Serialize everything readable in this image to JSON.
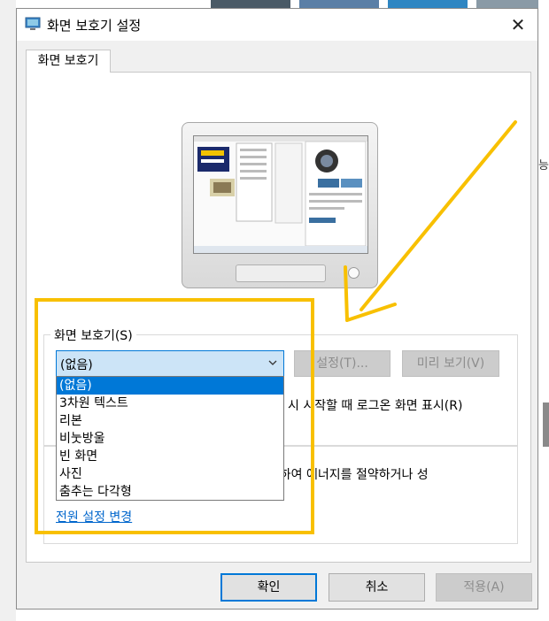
{
  "window": {
    "title": "화면 보호기 설정",
    "close_glyph": "✕",
    "icon": "monitor-icon"
  },
  "tab": {
    "label": "화면 보호기"
  },
  "screensaver": {
    "group_label": "화면 보호기(S)",
    "selected": "(없음)",
    "settings_button": "설정(T)...",
    "preview_button": "미리 보기(V)",
    "logon_text": "시 시작할 때 로그온 화면 표시(R)",
    "options": [
      "(없음)",
      "3차원 텍스트",
      "리본",
      "비눗방울",
      "빈 화면",
      "사진",
      "춤추는 다각형"
    ]
  },
  "power": {
    "text": "조정하여 에너지를 절약하거나 성",
    "link": "전원 설정 변경"
  },
  "buttons": {
    "ok": "확인",
    "cancel": "취소",
    "apply": "적용(A)"
  },
  "background": {
    "side_glyph": "능"
  },
  "colors": {
    "accent": "#0078d7",
    "annotation": "#f8c000",
    "link": "#0066cc"
  }
}
